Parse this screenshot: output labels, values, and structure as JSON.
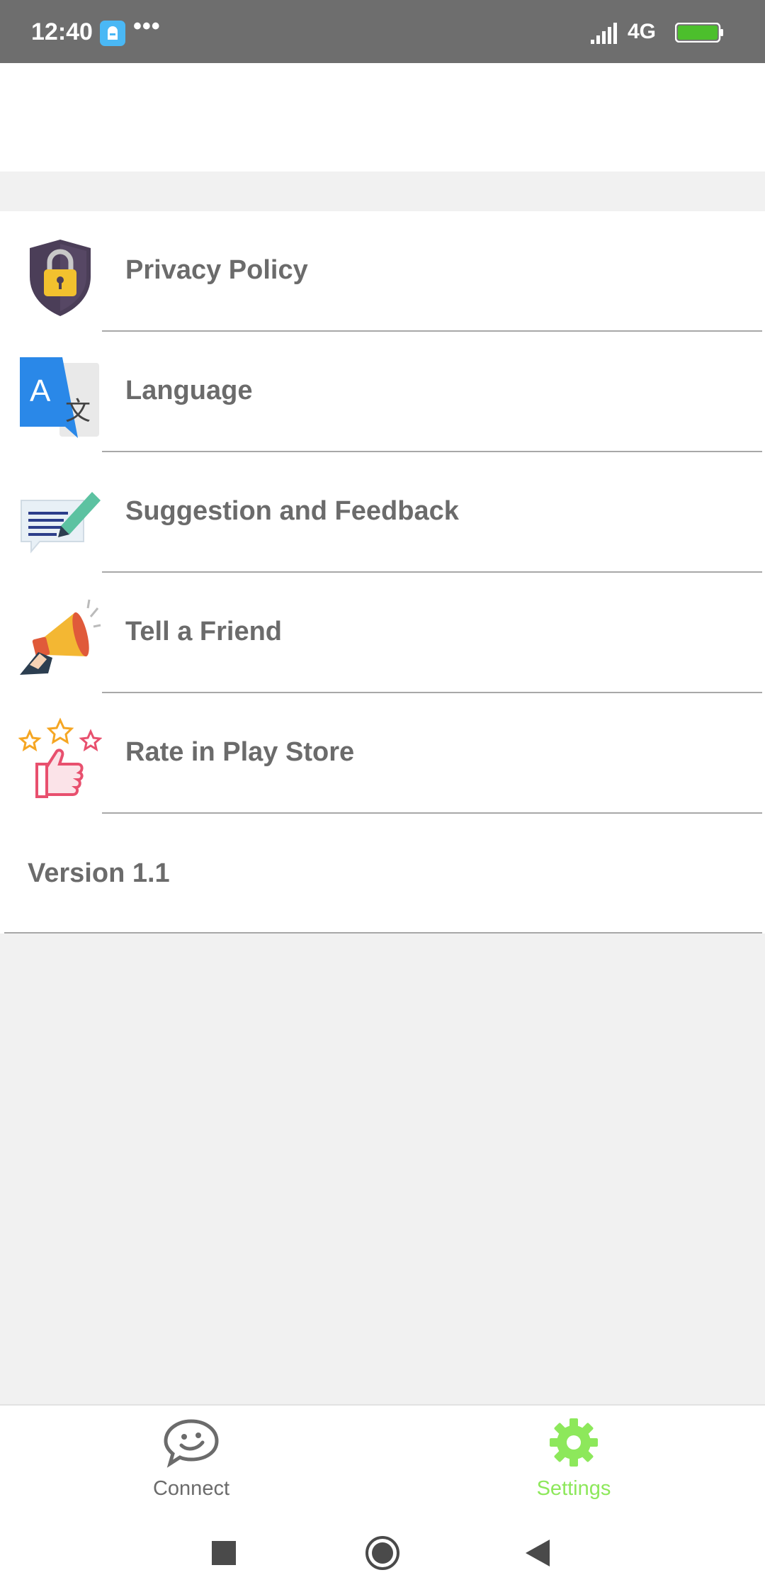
{
  "status_bar": {
    "time": "12:40",
    "overflow": "•••",
    "network": "4G",
    "battery": "100",
    "icons": [
      "app-notification-icon",
      "signal-icon",
      "battery-icon"
    ]
  },
  "settings": {
    "items": [
      {
        "label": "Privacy Policy",
        "icon": "lock-shield-icon"
      },
      {
        "label": "Language",
        "icon": "translate-icon"
      },
      {
        "label": "Suggestion and Feedback",
        "icon": "feedback-pencil-icon"
      },
      {
        "label": "Tell a Friend",
        "icon": "megaphone-icon"
      },
      {
        "label": "Rate in Play Store",
        "icon": "thumbs-up-stars-icon"
      }
    ],
    "version": "Version 1.1"
  },
  "bottom_nav": {
    "tabs": [
      {
        "label": "Connect",
        "icon": "chat-face-icon",
        "active": false
      },
      {
        "label": "Settings",
        "icon": "gear-icon",
        "active": true
      }
    ]
  },
  "colors": {
    "accent": "#8de85b",
    "text": "#6b6b6b",
    "status_bar": "#6e6e6e",
    "background": "#f1f1f1"
  },
  "system_nav": {
    "icons": [
      "recents-icon",
      "home-icon",
      "back-icon"
    ]
  }
}
